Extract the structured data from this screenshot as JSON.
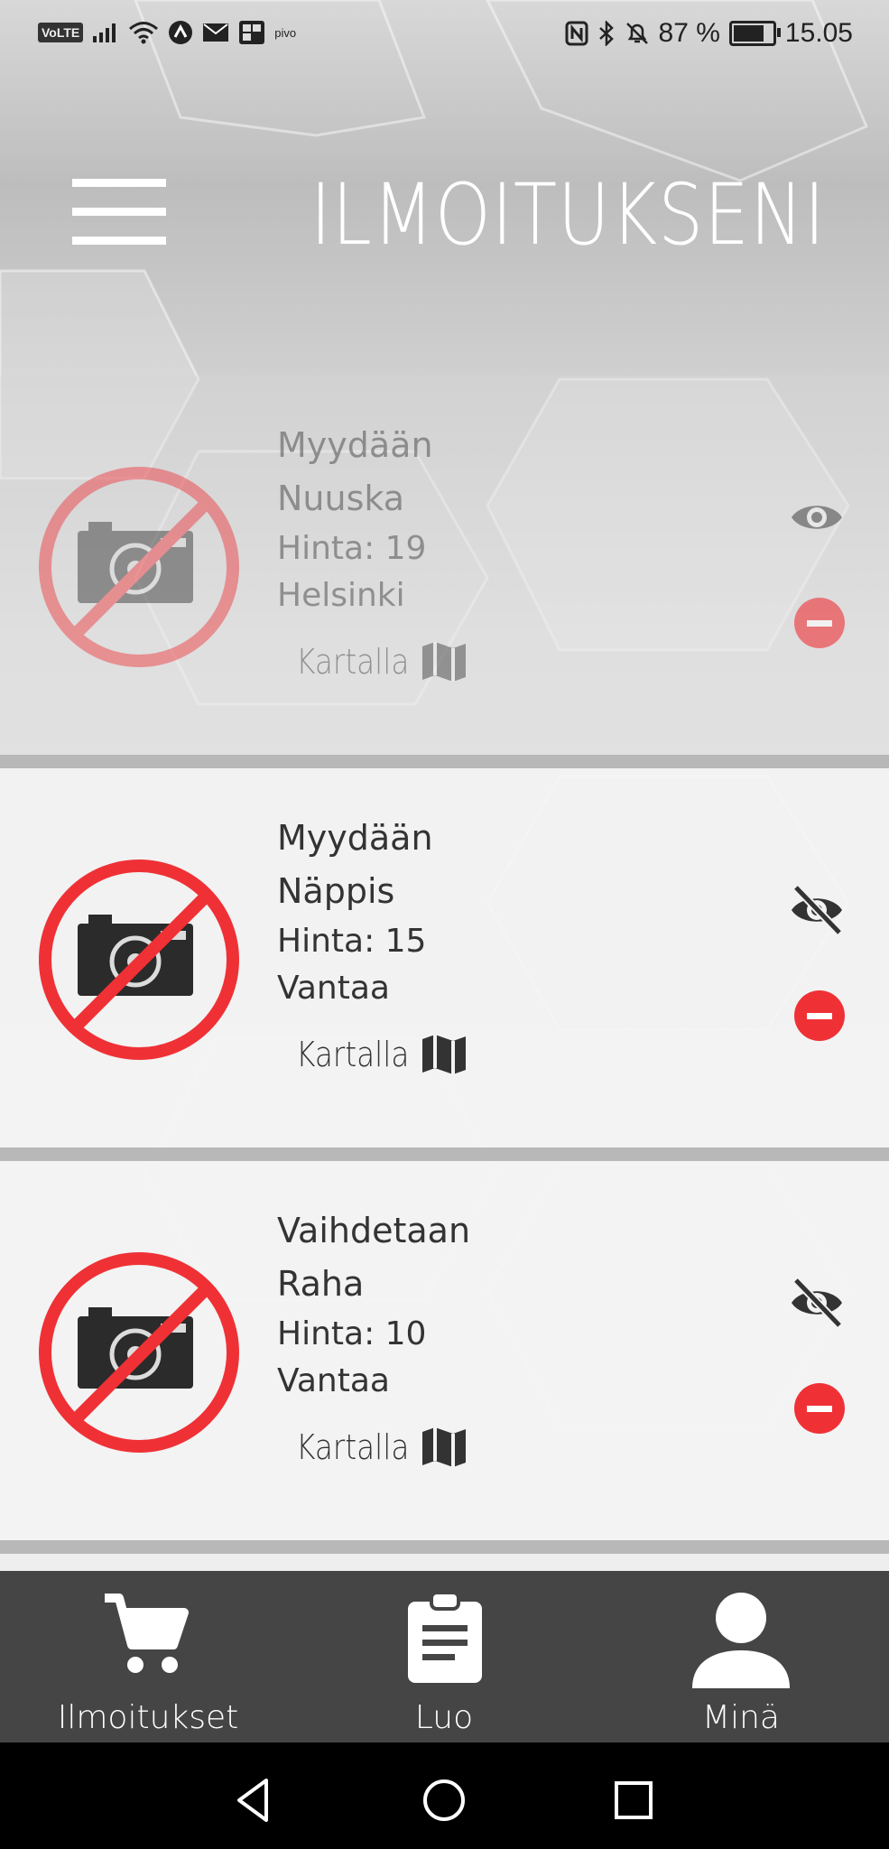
{
  "status_bar": {
    "volte": "VoLTE",
    "carrier_label": "pivo",
    "battery_text": "87 %",
    "battery_level": 0.87,
    "time": "15.05"
  },
  "header": {
    "title": "ILMOITUKSENI"
  },
  "listings": [
    {
      "title_line1": "Myydään",
      "title_line2": "Nuuska",
      "price": "Hinta: 19",
      "city": "Helsinki",
      "map_label": "Kartalla",
      "visibility_icon": "eye-icon",
      "hidden": true
    },
    {
      "title_line1": "Myydään",
      "title_line2": "Näppis",
      "price": "Hinta: 15",
      "city": "Vantaa",
      "map_label": "Kartalla",
      "visibility_icon": "eye-off-icon",
      "hidden": false
    },
    {
      "title_line1": "Vaihdetaan",
      "title_line2": "Raha",
      "price": "Hinta: 10",
      "city": "Vantaa",
      "map_label": "Kartalla",
      "visibility_icon": "eye-off-icon",
      "hidden": false
    }
  ],
  "bottom_nav": {
    "items": [
      {
        "label": "Ilmoitukset",
        "icon": "cart-icon"
      },
      {
        "label": "Luo",
        "icon": "clipboard-icon"
      },
      {
        "label": "Minä",
        "icon": "person-icon"
      }
    ]
  },
  "system_nav": {
    "buttons": [
      "back-icon",
      "home-icon",
      "recents-icon"
    ]
  },
  "colors": {
    "accent_red": "#ef3136",
    "bottom_nav_bg": "#454545",
    "text_dark": "#333333"
  }
}
